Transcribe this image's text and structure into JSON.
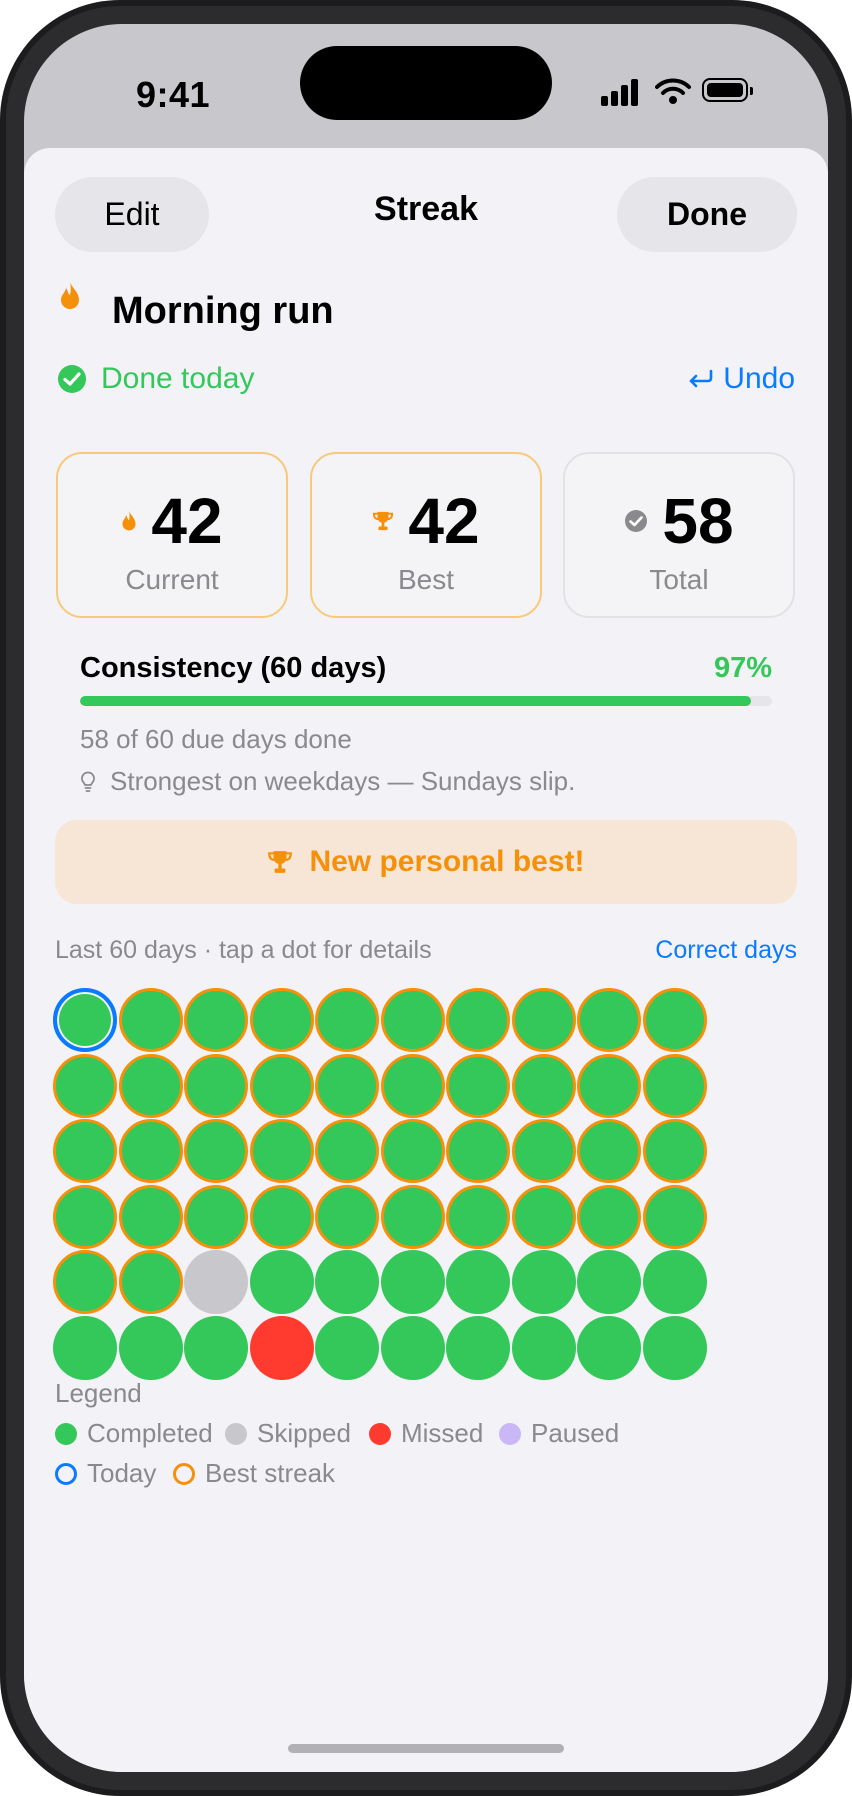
{
  "status_bar": {
    "time": "9:41"
  },
  "nav": {
    "edit_label": "Edit",
    "title": "Streak",
    "done_label": "Done"
  },
  "habit": {
    "icon": "flame-icon",
    "name": "Morning run",
    "status": "Done today",
    "undo_label": "Undo"
  },
  "stats": [
    {
      "icon": "flame-icon",
      "value": "42",
      "label": "Current"
    },
    {
      "icon": "trophy-icon",
      "value": "42",
      "label": "Best"
    },
    {
      "icon": "checkmark-icon",
      "value": "58",
      "label": "Total"
    }
  ],
  "consistency": {
    "title": "Consistency (60 days)",
    "percent_label": "97%",
    "percent": 0.97,
    "summary": "58 of 60 due days done",
    "insight": "Strongest on weekdays — Sundays slip."
  },
  "banner": {
    "icon": "trophy-icon",
    "text": "New personal best!"
  },
  "history": {
    "caption": "Last 60 days · tap a dot for details",
    "correct_label": "Correct days",
    "days": [
      "completed-today-best",
      "completed-best",
      "completed-best",
      "completed-best",
      "completed-best",
      "completed-best",
      "completed-best",
      "completed-best",
      "completed-best",
      "completed-best",
      "completed-best",
      "completed-best",
      "completed-best",
      "completed-best",
      "completed-best",
      "completed-best",
      "completed-best",
      "completed-best",
      "completed-best",
      "completed-best",
      "completed-best",
      "completed-best",
      "completed-best",
      "completed-best",
      "completed-best",
      "completed-best",
      "completed-best",
      "completed-best",
      "completed-best",
      "completed-best",
      "completed-best",
      "completed-best",
      "completed-best",
      "completed-best",
      "completed-best",
      "completed-best",
      "completed-best",
      "completed-best",
      "completed-best",
      "completed-best",
      "completed-best",
      "completed-best",
      "skipped",
      "completed",
      "completed",
      "completed",
      "completed",
      "completed",
      "completed",
      "completed",
      "completed",
      "completed",
      "completed",
      "missed",
      "completed",
      "completed",
      "completed",
      "completed",
      "completed",
      "completed"
    ]
  },
  "legend": {
    "title": "Legend",
    "items": [
      {
        "label": "Completed",
        "color": "#34c759",
        "style": "fill"
      },
      {
        "label": "Skipped",
        "color": "#c7c7cc",
        "style": "fill"
      },
      {
        "label": "Missed",
        "color": "#ff3b30",
        "style": "fill"
      },
      {
        "label": "Paused",
        "color": "#c9b8f5",
        "style": "fill"
      },
      {
        "label": "Today",
        "color": "#0a7aff",
        "style": "ring"
      },
      {
        "label": "Best streak",
        "color": "#f5900a",
        "style": "ring"
      }
    ]
  }
}
